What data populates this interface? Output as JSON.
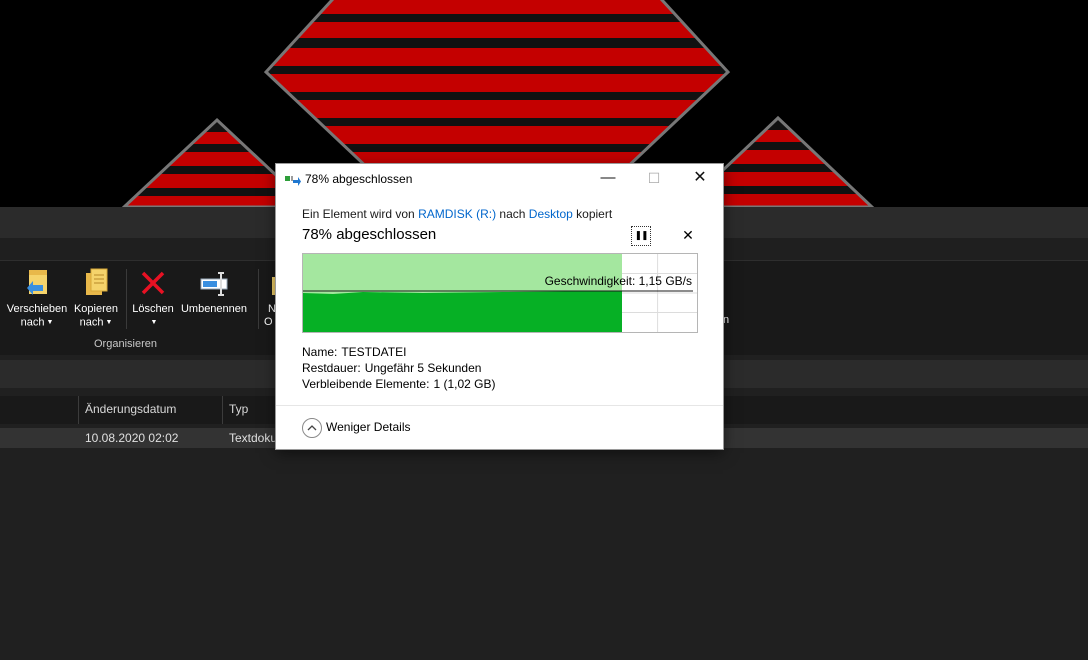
{
  "explorer": {
    "ribbon": {
      "move_label_1": "Verschieben",
      "move_label_2": "nach",
      "copy_label_1": "Kopieren",
      "copy_label_2": "nach",
      "delete_label": "Löschen",
      "rename_label": "Umbenennen",
      "partial_label_1": "N",
      "partial_label_2": "O",
      "partial_label_right": "n",
      "group_label": "Organisieren"
    },
    "columns": [
      "Änderungsdatum",
      "Typ"
    ],
    "rows": [
      {
        "date": "10.08.2020 02:02",
        "type": "Textdoku"
      }
    ]
  },
  "dialog": {
    "title": "78% abgeschlossen",
    "desc_prefix": "Ein Element wird von",
    "source": "RAMDISK (R:)",
    "desc_mid": "nach",
    "dest": "Desktop",
    "desc_suffix": "kopiert",
    "heading": "78% abgeschlossen",
    "progress": 0.78,
    "speed_label": "Geschwindigkeit:",
    "speed_value": "1,15 GB/s",
    "name_label": "Name:",
    "name_value": "TESTDATEI",
    "remaining_label": "Restdauer:",
    "remaining_value": "Ungefähr 5 Sekunden",
    "items_label": "Verbleibende Elemente:",
    "items_value": "1 (1,02 GB)",
    "toggle_label": "Weniger Details",
    "colors": {
      "graph_filled": "#06b025",
      "graph_light": "#a4e79f",
      "link": "#0066cc"
    }
  }
}
